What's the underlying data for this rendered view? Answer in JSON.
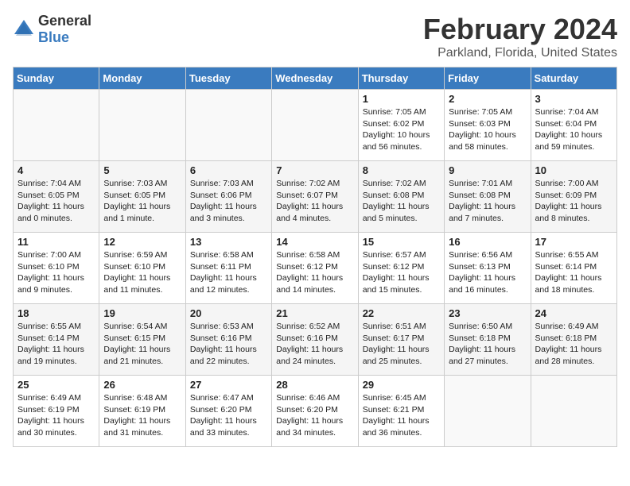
{
  "title": "February 2024",
  "subtitle": "Parkland, Florida, United States",
  "logo": {
    "general": "General",
    "blue": "Blue"
  },
  "days_of_week": [
    "Sunday",
    "Monday",
    "Tuesday",
    "Wednesday",
    "Thursday",
    "Friday",
    "Saturday"
  ],
  "weeks": [
    [
      {
        "day": "",
        "info": ""
      },
      {
        "day": "",
        "info": ""
      },
      {
        "day": "",
        "info": ""
      },
      {
        "day": "",
        "info": ""
      },
      {
        "day": "1",
        "info": "Sunrise: 7:05 AM\nSunset: 6:02 PM\nDaylight: 10 hours and 56 minutes."
      },
      {
        "day": "2",
        "info": "Sunrise: 7:05 AM\nSunset: 6:03 PM\nDaylight: 10 hours and 58 minutes."
      },
      {
        "day": "3",
        "info": "Sunrise: 7:04 AM\nSunset: 6:04 PM\nDaylight: 10 hours and 59 minutes."
      }
    ],
    [
      {
        "day": "4",
        "info": "Sunrise: 7:04 AM\nSunset: 6:05 PM\nDaylight: 11 hours and 0 minutes."
      },
      {
        "day": "5",
        "info": "Sunrise: 7:03 AM\nSunset: 6:05 PM\nDaylight: 11 hours and 1 minute."
      },
      {
        "day": "6",
        "info": "Sunrise: 7:03 AM\nSunset: 6:06 PM\nDaylight: 11 hours and 3 minutes."
      },
      {
        "day": "7",
        "info": "Sunrise: 7:02 AM\nSunset: 6:07 PM\nDaylight: 11 hours and 4 minutes."
      },
      {
        "day": "8",
        "info": "Sunrise: 7:02 AM\nSunset: 6:08 PM\nDaylight: 11 hours and 5 minutes."
      },
      {
        "day": "9",
        "info": "Sunrise: 7:01 AM\nSunset: 6:08 PM\nDaylight: 11 hours and 7 minutes."
      },
      {
        "day": "10",
        "info": "Sunrise: 7:00 AM\nSunset: 6:09 PM\nDaylight: 11 hours and 8 minutes."
      }
    ],
    [
      {
        "day": "11",
        "info": "Sunrise: 7:00 AM\nSunset: 6:10 PM\nDaylight: 11 hours and 9 minutes."
      },
      {
        "day": "12",
        "info": "Sunrise: 6:59 AM\nSunset: 6:10 PM\nDaylight: 11 hours and 11 minutes."
      },
      {
        "day": "13",
        "info": "Sunrise: 6:58 AM\nSunset: 6:11 PM\nDaylight: 11 hours and 12 minutes."
      },
      {
        "day": "14",
        "info": "Sunrise: 6:58 AM\nSunset: 6:12 PM\nDaylight: 11 hours and 14 minutes."
      },
      {
        "day": "15",
        "info": "Sunrise: 6:57 AM\nSunset: 6:12 PM\nDaylight: 11 hours and 15 minutes."
      },
      {
        "day": "16",
        "info": "Sunrise: 6:56 AM\nSunset: 6:13 PM\nDaylight: 11 hours and 16 minutes."
      },
      {
        "day": "17",
        "info": "Sunrise: 6:55 AM\nSunset: 6:14 PM\nDaylight: 11 hours and 18 minutes."
      }
    ],
    [
      {
        "day": "18",
        "info": "Sunrise: 6:55 AM\nSunset: 6:14 PM\nDaylight: 11 hours and 19 minutes."
      },
      {
        "day": "19",
        "info": "Sunrise: 6:54 AM\nSunset: 6:15 PM\nDaylight: 11 hours and 21 minutes."
      },
      {
        "day": "20",
        "info": "Sunrise: 6:53 AM\nSunset: 6:16 PM\nDaylight: 11 hours and 22 minutes."
      },
      {
        "day": "21",
        "info": "Sunrise: 6:52 AM\nSunset: 6:16 PM\nDaylight: 11 hours and 24 minutes."
      },
      {
        "day": "22",
        "info": "Sunrise: 6:51 AM\nSunset: 6:17 PM\nDaylight: 11 hours and 25 minutes."
      },
      {
        "day": "23",
        "info": "Sunrise: 6:50 AM\nSunset: 6:18 PM\nDaylight: 11 hours and 27 minutes."
      },
      {
        "day": "24",
        "info": "Sunrise: 6:49 AM\nSunset: 6:18 PM\nDaylight: 11 hours and 28 minutes."
      }
    ],
    [
      {
        "day": "25",
        "info": "Sunrise: 6:49 AM\nSunset: 6:19 PM\nDaylight: 11 hours and 30 minutes."
      },
      {
        "day": "26",
        "info": "Sunrise: 6:48 AM\nSunset: 6:19 PM\nDaylight: 11 hours and 31 minutes."
      },
      {
        "day": "27",
        "info": "Sunrise: 6:47 AM\nSunset: 6:20 PM\nDaylight: 11 hours and 33 minutes."
      },
      {
        "day": "28",
        "info": "Sunrise: 6:46 AM\nSunset: 6:20 PM\nDaylight: 11 hours and 34 minutes."
      },
      {
        "day": "29",
        "info": "Sunrise: 6:45 AM\nSunset: 6:21 PM\nDaylight: 11 hours and 36 minutes."
      },
      {
        "day": "",
        "info": ""
      },
      {
        "day": "",
        "info": ""
      }
    ]
  ]
}
